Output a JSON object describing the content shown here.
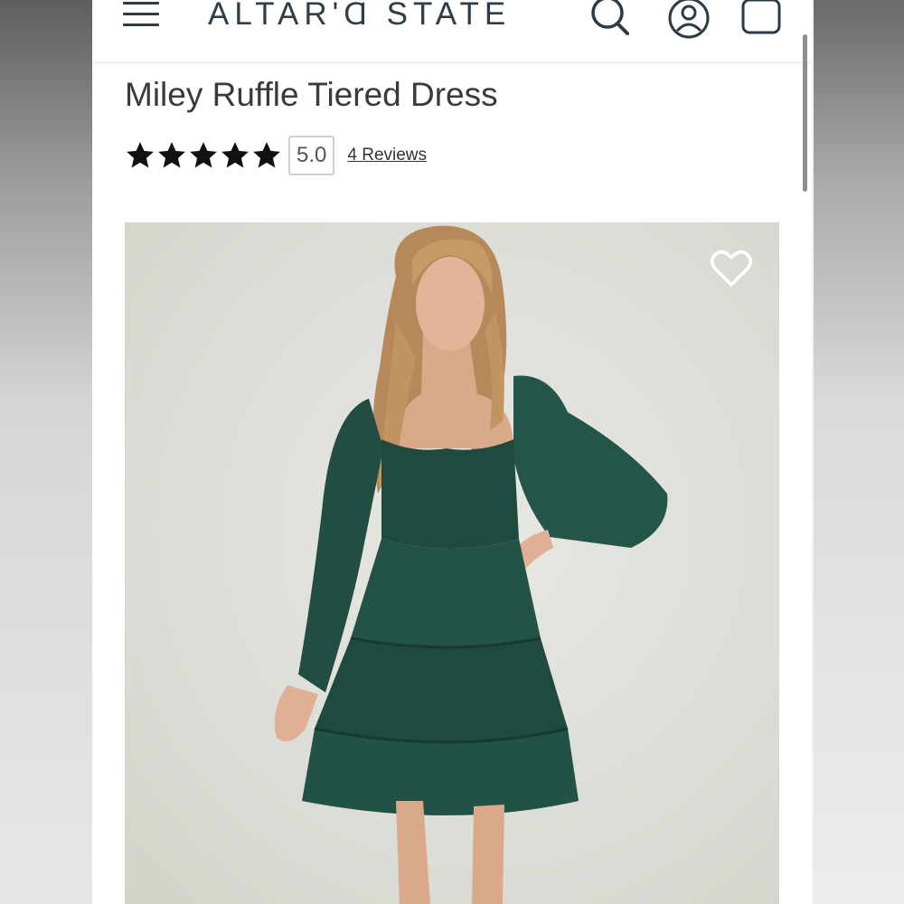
{
  "header": {
    "brand": "ALTAR'Ɑ STATE",
    "icons": [
      "hamburger-menu-icon",
      "search-icon",
      "account-icon",
      "shopping-bag-icon"
    ]
  },
  "product": {
    "title": "Miley Ruffle Tiered Dress",
    "rating": {
      "stars": 5,
      "score": "5.0",
      "reviews_label": "4 Reviews"
    },
    "image": {
      "wishlist_icon": "heart-outline-icon"
    }
  },
  "colors": {
    "text_dark": "#2f3e46",
    "dress_green": "#1f4a40",
    "background": "#ffffff"
  }
}
